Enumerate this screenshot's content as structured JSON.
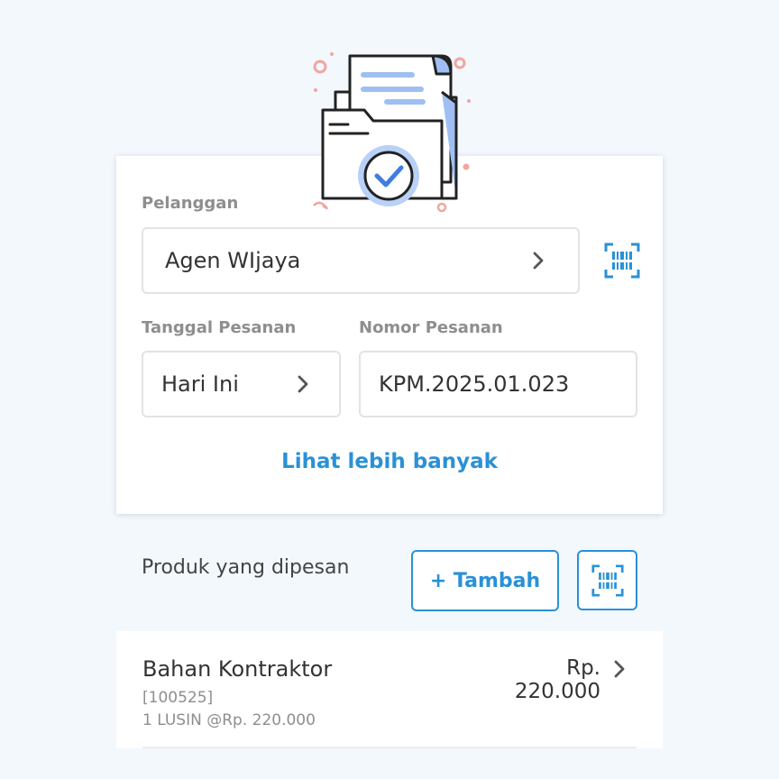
{
  "form": {
    "customer_label": "Pelanggan",
    "customer_value": "Agen WIjaya",
    "date_label": "Tanggal Pesanan",
    "date_value": "Hari Ini",
    "order_no_label": "Nomor Pesanan",
    "order_no_value": "KPM.2025.01.023",
    "more_link": "Lihat lebih banyak"
  },
  "products": {
    "section_title": "Produk yang dipesan",
    "add_button": "+ Tambah",
    "items": [
      {
        "name": "Bahan Kontraktor",
        "price": "Rp. 220.000",
        "code": "[100525]",
        "qty": "1 LUSIN @Rp. 220.000"
      }
    ]
  },
  "icons": {
    "barcode": "barcode-scan-icon",
    "chevron": "chevron-right-icon",
    "illustration": "document-folder-check-icon"
  },
  "colors": {
    "accent": "#2a91d6",
    "background": "#f3f8fd"
  }
}
